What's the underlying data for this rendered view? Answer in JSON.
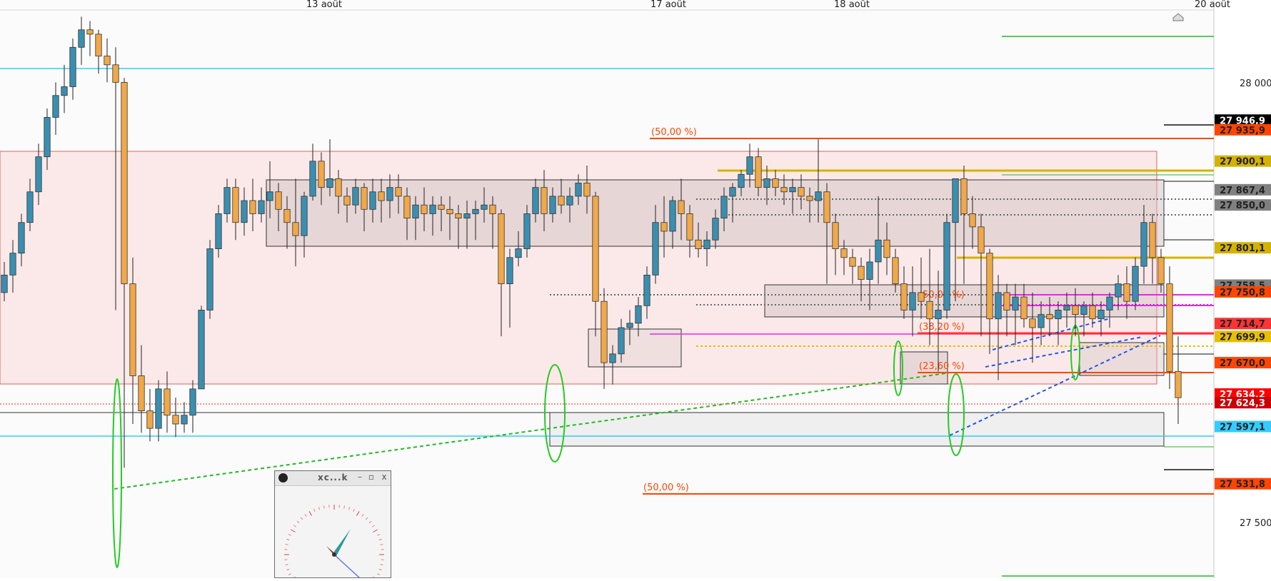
{
  "chart_data": {
    "type": "candlestick",
    "x_tick_labels": [
      "13 août",
      "17 août",
      "18 août",
      "20 août"
    ],
    "y_tick_labels": [
      {
        "value": 28000.0,
        "label": "28 000,0"
      },
      {
        "value": 27500.0,
        "label": "27 500,0"
      }
    ],
    "ylim": [
      27424,
      28084
    ],
    "grid": false,
    "candles": [
      [
        27750,
        27785,
        27740,
        27770
      ],
      [
        27770,
        27810,
        27750,
        27795
      ],
      [
        27795,
        27840,
        27780,
        27830
      ],
      [
        27830,
        27880,
        27820,
        27865
      ],
      [
        27865,
        27920,
        27850,
        27905
      ],
      [
        27905,
        27960,
        27890,
        27950
      ],
      [
        27950,
        27990,
        27930,
        27975
      ],
      [
        27975,
        28010,
        27955,
        27985
      ],
      [
        27985,
        28040,
        27970,
        28030
      ],
      [
        28030,
        28065,
        28010,
        28050
      ],
      [
        28050,
        28060,
        28020,
        28045
      ],
      [
        28045,
        28050,
        28000,
        28020
      ],
      [
        28020,
        28040,
        27990,
        28010
      ],
      [
        28010,
        28030,
        27730,
        27990
      ],
      [
        27990,
        27995,
        27550,
        27760
      ],
      [
        27760,
        27790,
        27600,
        27655
      ],
      [
        27655,
        27690,
        27590,
        27615
      ],
      [
        27615,
        27640,
        27580,
        27595
      ],
      [
        27595,
        27650,
        27580,
        27640
      ],
      [
        27640,
        27660,
        27590,
        27610
      ],
      [
        27610,
        27630,
        27585,
        27600
      ],
      [
        27600,
        27625,
        27590,
        27610
      ],
      [
        27610,
        27650,
        27590,
        27640
      ],
      [
        27640,
        27735,
        27640,
        27730
      ],
      [
        27730,
        27810,
        27720,
        27800
      ],
      [
        27800,
        27850,
        27790,
        27840
      ],
      [
        27840,
        27880,
        27830,
        27870
      ],
      [
        27870,
        27880,
        27810,
        27830
      ],
      [
        27830,
        27870,
        27815,
        27855
      ],
      [
        27855,
        27880,
        27820,
        27840
      ],
      [
        27840,
        27870,
        27830,
        27855
      ],
      [
        27855,
        27900,
        27835,
        27865
      ],
      [
        27865,
        27875,
        27820,
        27845
      ],
      [
        27845,
        27860,
        27800,
        27830
      ],
      [
        27830,
        27880,
        27780,
        27815
      ],
      [
        27815,
        27865,
        27790,
        27860
      ],
      [
        27860,
        27920,
        27855,
        27900
      ],
      [
        27900,
        27910,
        27850,
        27870
      ],
      [
        27870,
        27925,
        27860,
        27880
      ],
      [
        27880,
        27890,
        27840,
        27860
      ],
      [
        27860,
        27870,
        27830,
        27850
      ],
      [
        27850,
        27880,
        27840,
        27870
      ],
      [
        27870,
        27875,
        27820,
        27845
      ],
      [
        27845,
        27880,
        27830,
        27865
      ],
      [
        27865,
        27880,
        27830,
        27855
      ],
      [
        27855,
        27885,
        27835,
        27870
      ],
      [
        27870,
        27885,
        27840,
        27860
      ],
      [
        27860,
        27870,
        27810,
        27835
      ],
      [
        27835,
        27860,
        27810,
        27850
      ],
      [
        27850,
        27870,
        27820,
        27840
      ],
      [
        27840,
        27860,
        27815,
        27850
      ],
      [
        27850,
        27860,
        27820,
        27845
      ],
      [
        27845,
        27860,
        27810,
        27840
      ],
      [
        27840,
        27850,
        27800,
        27835
      ],
      [
        27835,
        27855,
        27800,
        27840
      ],
      [
        27840,
        27855,
        27810,
        27845
      ],
      [
        27845,
        27870,
        27830,
        27850
      ],
      [
        27850,
        27860,
        27800,
        27840
      ],
      [
        27840,
        27845,
        27700,
        27760
      ],
      [
        27760,
        27800,
        27710,
        27790
      ],
      [
        27790,
        27820,
        27780,
        27800
      ],
      [
        27800,
        27850,
        27790,
        27840
      ],
      [
        27840,
        27880,
        27830,
        27870
      ],
      [
        27870,
        27890,
        27820,
        27840
      ],
      [
        27840,
        27870,
        27830,
        27860
      ],
      [
        27860,
        27880,
        27840,
        27850
      ],
      [
        27850,
        27870,
        27830,
        27860
      ],
      [
        27860,
        27885,
        27850,
        27875
      ],
      [
        27875,
        27895,
        27840,
        27860
      ],
      [
        27860,
        27865,
        27700,
        27740
      ],
      [
        27740,
        27755,
        27640,
        27670
      ],
      [
        27670,
        27690,
        27645,
        27680
      ],
      [
        27680,
        27720,
        27670,
        27710
      ],
      [
        27710,
        27730,
        27690,
        27715
      ],
      [
        27715,
        27745,
        27700,
        27735
      ],
      [
        27735,
        27780,
        27720,
        27770
      ],
      [
        27770,
        27850,
        27760,
        27830
      ],
      [
        27830,
        27860,
        27790,
        27820
      ],
      [
        27820,
        27860,
        27800,
        27855
      ],
      [
        27855,
        27880,
        27810,
        27840
      ],
      [
        27840,
        27850,
        27790,
        27810
      ],
      [
        27810,
        27830,
        27790,
        27800
      ],
      [
        27800,
        27820,
        27780,
        27810
      ],
      [
        27810,
        27845,
        27800,
        27835
      ],
      [
        27835,
        27870,
        27820,
        27860
      ],
      [
        27860,
        27875,
        27830,
        27870
      ],
      [
        27870,
        27890,
        27860,
        27885
      ],
      [
        27885,
        27920,
        27870,
        27905
      ],
      [
        27905,
        27915,
        27860,
        27870
      ],
      [
        27870,
        27895,
        27850,
        27880
      ],
      [
        27880,
        27890,
        27860,
        27870
      ],
      [
        27870,
        27885,
        27850,
        27865
      ],
      [
        27865,
        27880,
        27840,
        27870
      ],
      [
        27870,
        27885,
        27845,
        27860
      ],
      [
        27860,
        27870,
        27830,
        27855
      ],
      [
        27855,
        27925,
        27830,
        27865
      ],
      [
        27865,
        27875,
        27760,
        27830
      ],
      [
        27830,
        27840,
        27770,
        27800
      ],
      [
        27800,
        27810,
        27770,
        27790
      ],
      [
        27790,
        27800,
        27760,
        27780
      ],
      [
        27780,
        27790,
        27740,
        27765
      ],
      [
        27765,
        27800,
        27730,
        27785
      ],
      [
        27785,
        27860,
        27760,
        27810
      ],
      [
        27810,
        27830,
        27770,
        27790
      ],
      [
        27790,
        27800,
        27750,
        27760
      ],
      [
        27760,
        27780,
        27720,
        27730
      ],
      [
        27730,
        27780,
        27700,
        27750
      ],
      [
        27750,
        27790,
        27720,
        27740
      ],
      [
        27740,
        27800,
        27690,
        27720
      ],
      [
        27720,
        27775,
        27660,
        27730
      ],
      [
        27730,
        27840,
        27720,
        27830
      ],
      [
        27830,
        27870,
        27740,
        27880
      ],
      [
        27880,
        27895,
        27760,
        27840
      ],
      [
        27840,
        27860,
        27800,
        27825
      ],
      [
        27825,
        27840,
        27700,
        27795
      ],
      [
        27795,
        27800,
        27680,
        27720
      ],
      [
        27720,
        27770,
        27650,
        27750
      ],
      [
        27750,
        27760,
        27700,
        27730
      ],
      [
        27730,
        27760,
        27690,
        27745
      ],
      [
        27745,
        27760,
        27710,
        27720
      ],
      [
        27720,
        27750,
        27670,
        27710
      ],
      [
        27710,
        27740,
        27690,
        27725
      ],
      [
        27725,
        27745,
        27700,
        27720
      ],
      [
        27720,
        27740,
        27690,
        27730
      ],
      [
        27730,
        27750,
        27710,
        27735
      ],
      [
        27735,
        27755,
        27700,
        27725
      ],
      [
        27725,
        27740,
        27700,
        27735
      ],
      [
        27735,
        27750,
        27710,
        27720
      ],
      [
        27720,
        27740,
        27700,
        27730
      ],
      [
        27730,
        27750,
        27710,
        27745
      ],
      [
        27745,
        27770,
        27730,
        27760
      ],
      [
        27760,
        27780,
        27720,
        27740
      ],
      [
        27740,
        27790,
        27730,
        27780
      ],
      [
        27780,
        27850,
        27760,
        27830
      ],
      [
        27830,
        27840,
        27760,
        27790
      ],
      [
        27790,
        27800,
        27750,
        27760
      ],
      [
        27760,
        27780,
        27640,
        27660
      ],
      [
        27660,
        27700,
        27600,
        27630
      ]
    ],
    "horizontal_levels": [
      {
        "price": 27946.9,
        "label": "27 946,9",
        "color": "#000000"
      },
      {
        "price": 27935.9,
        "label": "27 935,9",
        "color": "#ff4500"
      },
      {
        "price": 27900.1,
        "label": "27 900,1",
        "color": "#d4b300"
      },
      {
        "price": 27867.4,
        "label": "27 867,4",
        "color": "#808080"
      },
      {
        "price": 27850.0,
        "label": "27 850,0",
        "color": "#808080"
      },
      {
        "price": 27801.1,
        "label": "27 801,1",
        "color": "#d4b300"
      },
      {
        "price": 27758.5,
        "label": "27 758,5",
        "color": "#808080"
      },
      {
        "price": 27750.8,
        "label": "27 750,8",
        "color": "#ff4500"
      },
      {
        "price": 27714.7,
        "label": "27 714,7",
        "color": "#ff3333"
      },
      {
        "price": 27699.9,
        "label": "27 699,9",
        "color": "#e6c000"
      },
      {
        "price": 27670.0,
        "label": "27 670,0",
        "color": "#ff4500"
      },
      {
        "price": 27634.2,
        "label": "27 634,2",
        "color": "#ff0000"
      },
      {
        "price": 27624.3,
        "label": "27 624,3",
        "color": "#cc0000"
      },
      {
        "price": 27597.1,
        "label": "27 597,1",
        "color": "#33ccff"
      },
      {
        "price": 27531.8,
        "label": "27 531,8",
        "color": "#ff4500"
      }
    ],
    "annotations": [
      "(50,00 %)",
      "(50,00 %)",
      "(38,20 %)",
      "(23,60 %)",
      "(50,00 %)"
    ]
  },
  "widget": {
    "title": "xc...k",
    "minimize": "–",
    "maximize": "▫",
    "close": "x"
  },
  "icons": {
    "scroll_home": "home-icon",
    "clock_app": "clock-icon"
  }
}
